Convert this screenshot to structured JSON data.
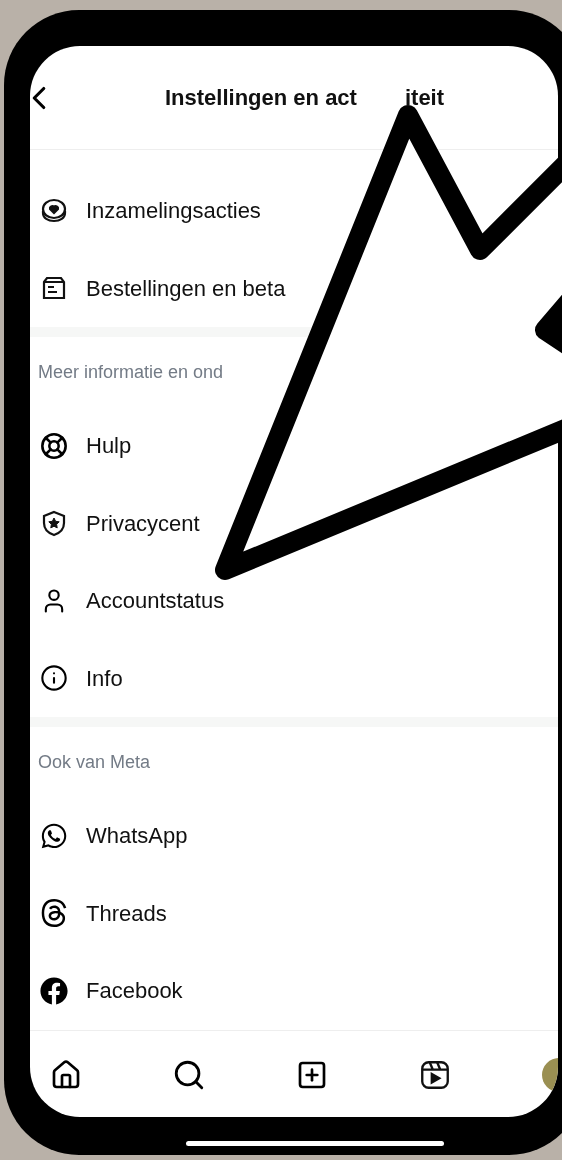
{
  "header": {
    "title_start": "Instellingen en act",
    "title_end": "iteit"
  },
  "sections": [
    {
      "items": [
        "Inzamelingsacties",
        "Bestellingen en beta"
      ]
    },
    {
      "heading": "Meer informatie en ond",
      "items": [
        "Hulp",
        "Privacycent",
        "Accountstatus",
        "Info"
      ]
    },
    {
      "heading": "Ook van Meta",
      "items": [
        "WhatsApp",
        "Threads",
        "Facebook"
      ]
    }
  ]
}
